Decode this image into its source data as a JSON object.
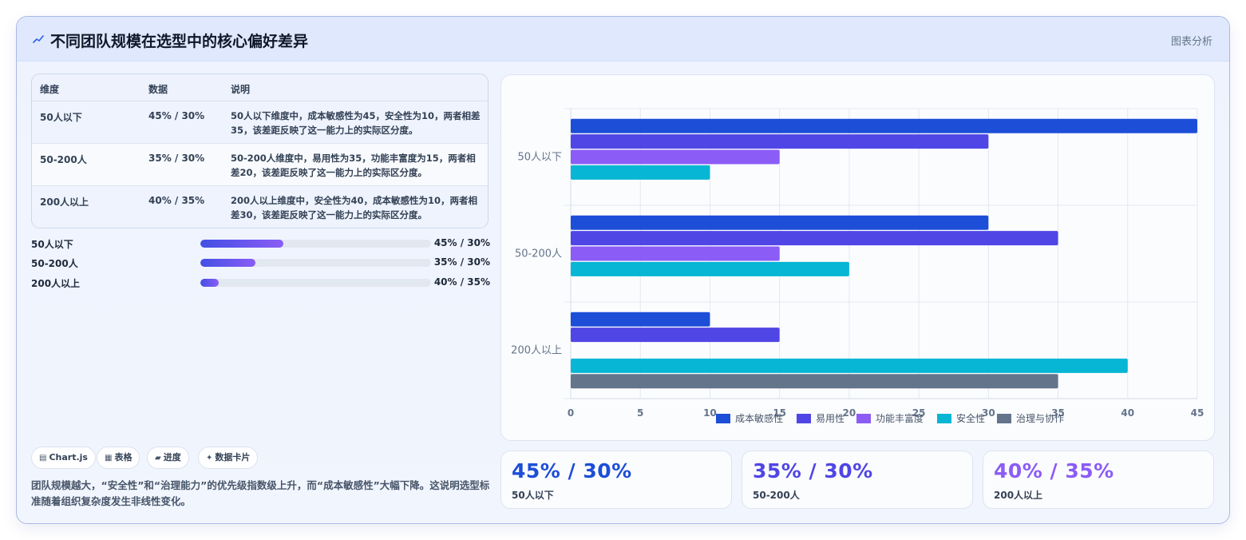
{
  "header": {
    "title": "不同团队规模在选型中的核心偏好差异",
    "right_label": "图表分析"
  },
  "table": {
    "columns": [
      "维度",
      "数据",
      "说明"
    ],
    "rows": [
      {
        "dimension": "50人以下",
        "data": "45% / 30%",
        "desc": "50人以下维度中，成本敏感性为45，安全性为10，两者相差35，该差距反映了这一能力上的实际区分度。"
      },
      {
        "dimension": "50-200人",
        "data": "35% / 30%",
        "desc": "50-200人维度中，易用性为35，功能丰富度为15，两者相差20，该差距反映了这一能力上的实际区分度。"
      },
      {
        "dimension": "200人以上",
        "data": "40% / 35%",
        "desc": "200人以上维度中，安全性为40，成本敏感性为10，两者相差30，该差距反映了这一能力上的实际区分度。"
      }
    ]
  },
  "progress": [
    {
      "label": "50人以下",
      "value_text": "45% / 30%",
      "fill": 0.36
    },
    {
      "label": "50-200人",
      "value_text": "35% / 30%",
      "fill": 0.24
    },
    {
      "label": "200人以上",
      "value_text": "40% / 35%",
      "fill": 0.08
    }
  ],
  "chips": [
    {
      "icon": "chart-icon",
      "glyph": "▤",
      "label": "Chart.js"
    },
    {
      "icon": "table-icon",
      "glyph": "▦",
      "label": "表格"
    },
    {
      "icon": "progress-icon",
      "glyph": "▰",
      "label": "进度"
    },
    {
      "icon": "card-icon",
      "glyph": "✦",
      "label": "数据卡片"
    }
  ],
  "summary": "团队规模越大，“安全性”和“治理能力”的优先级指数级上升，而“成本敏感性”大幅下降。这说明选型标准随着组织复杂度发生非线性变化。",
  "kpis": [
    {
      "value": "45% / 30%",
      "label": "50人以下",
      "color": "#1d4ed8"
    },
    {
      "value": "35% / 30%",
      "label": "50-200人",
      "color": "#4f46e5"
    },
    {
      "value": "40% / 35%",
      "label": "200人以上",
      "color": "#8b5cf6"
    }
  ],
  "chart_data": {
    "type": "bar",
    "orientation": "horizontal",
    "categories": [
      "50人以下",
      "50-200人",
      "200人以上"
    ],
    "series": [
      {
        "name": "成本敏感性",
        "values": [
          45,
          30,
          10
        ],
        "color": "#1d4ed8"
      },
      {
        "name": "易用性",
        "values": [
          30,
          35,
          15
        ],
        "color": "#4f46e5"
      },
      {
        "name": "功能丰富度",
        "values": [
          15,
          15,
          0
        ],
        "color": "#8b5cf6"
      },
      {
        "name": "安全性",
        "values": [
          10,
          20,
          40
        ],
        "color": "#06b6d4"
      },
      {
        "name": "治理与协作",
        "values": [
          0,
          0,
          35
        ],
        "color": "#64748b"
      }
    ],
    "xlim": [
      0,
      45
    ],
    "xticks": [
      0,
      5,
      10,
      15,
      20,
      25,
      30,
      35,
      40,
      45
    ],
    "grid": true,
    "legend": "bottom"
  }
}
